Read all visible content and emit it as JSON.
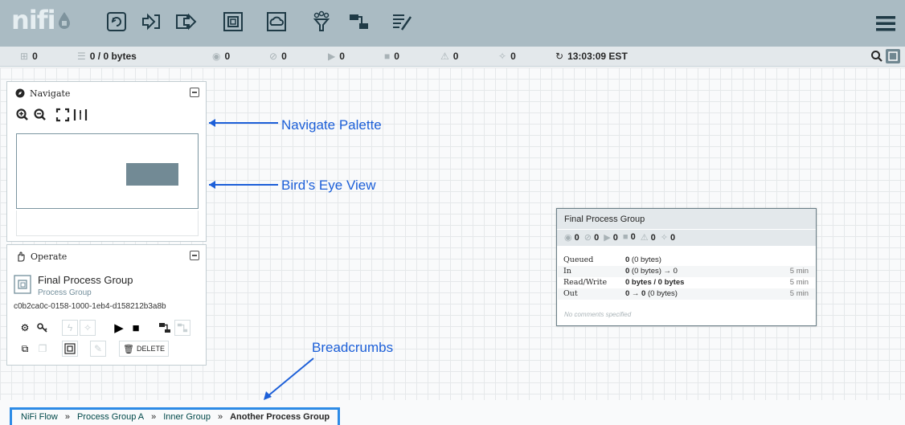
{
  "header": {
    "logo_text": "nifi",
    "toolbar_icons": [
      "processor-icon",
      "input-port-icon",
      "output-port-icon",
      "process-group-icon",
      "remote-process-group-icon",
      "funnel-icon",
      "template-icon",
      "label-icon"
    ],
    "menu_icon": "hamburger-icon"
  },
  "status": {
    "threads": "0",
    "queued": "0 / 0 bytes",
    "transmitting": "0",
    "not_transmitting": "0",
    "running": "0",
    "stopped": "0",
    "invalid": "0",
    "disabled": "0",
    "refresh_time": "13:03:09 EST"
  },
  "navigate": {
    "title": "Navigate"
  },
  "operate": {
    "title": "Operate",
    "component_name": "Final Process Group",
    "component_type": "Process Group",
    "component_id": "c0b2ca0c-0158-1000-1eb4-d158212b3a8b",
    "delete_label": "DELETE"
  },
  "process_group": {
    "name": "Final Process Group",
    "stats": [
      "0",
      "0",
      "0",
      "0",
      "0",
      "0"
    ],
    "rows": [
      {
        "label": "Queued",
        "value_bold": "0",
        "value_rest": " (0 bytes)",
        "time": ""
      },
      {
        "label": "In",
        "value_bold": "0",
        "value_rest": " (0 bytes) → 0",
        "time": "5 min"
      },
      {
        "label": "Read/Write",
        "value_bold": "0 bytes / 0 bytes",
        "value_rest": "",
        "time": "5 min"
      },
      {
        "label": "Out",
        "value_bold": "0 → 0",
        "value_rest": " (0 bytes)",
        "time": "5 min"
      }
    ],
    "comments": "No comments specified"
  },
  "annotations": {
    "navigate_palette": "Navigate Palette",
    "birds_eye_view": "Bird’s Eye View",
    "breadcrumbs": "Breadcrumbs"
  },
  "breadcrumbs": {
    "items": [
      "NiFi Flow",
      "Process Group A",
      "Inner Group",
      "Another Process Group"
    ],
    "separator": "»"
  },
  "colors": {
    "header_bg": "#aabbc3",
    "accent_blue": "#1c5fd8",
    "group_fill": "#728a95"
  }
}
